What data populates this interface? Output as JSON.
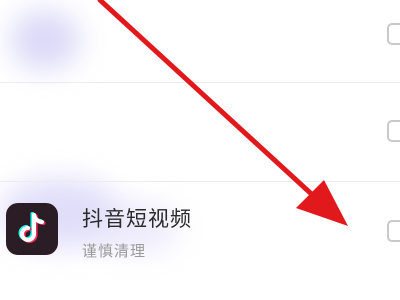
{
  "list": {
    "items": [
      {
        "name": "",
        "subtitle": "",
        "checked": false,
        "blurred": true
      },
      {
        "name": "",
        "subtitle": "",
        "checked": false,
        "blurred": true
      },
      {
        "name": "抖音短视频",
        "subtitle": "谨慎清理",
        "checked": false,
        "icon": "tiktok-icon"
      }
    ]
  },
  "colors": {
    "annotation_arrow": "#e2191c",
    "icon_bg": "#2a1d25",
    "checkbox_border": "#c9c9c9"
  }
}
